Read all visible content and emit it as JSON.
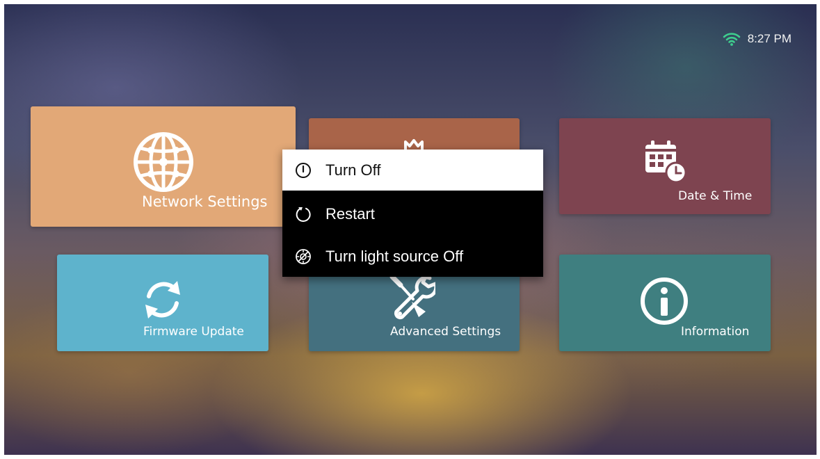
{
  "status_bar": {
    "time": "8:27 PM",
    "wifi_icon": "wifi-icon"
  },
  "tiles": {
    "network": {
      "label": "Network Settings",
      "icon": "globe-network-icon",
      "color": "#e2a877"
    },
    "picture": {
      "label": "",
      "icon": "picture-icon",
      "color": "#a96449"
    },
    "datetime": {
      "label": "Date & Time",
      "icon": "calendar-clock-icon",
      "color": "#7e4450"
    },
    "firmware": {
      "label": "Firmware Update",
      "icon": "refresh-icon",
      "color": "#5eb3cc"
    },
    "advanced": {
      "label": "Advanced Settings",
      "icon": "wrench-screwdriver-icon",
      "color": "#44707f"
    },
    "information": {
      "label": "Information",
      "icon": "info-icon",
      "color": "#3f7f80"
    }
  },
  "power_menu": {
    "items": [
      {
        "label": "Turn Off",
        "icon": "power-icon",
        "selected": true
      },
      {
        "label": "Restart",
        "icon": "restart-icon",
        "selected": false
      },
      {
        "label": "Turn light source Off",
        "icon": "light-source-off-icon",
        "selected": false
      }
    ]
  }
}
